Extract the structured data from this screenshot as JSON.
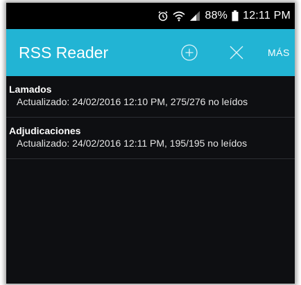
{
  "status_bar": {
    "battery_percent": "88%",
    "time": "12:11 PM",
    "icons": [
      "alarm-icon",
      "wifi-icon",
      "signal-icon",
      "battery-icon"
    ]
  },
  "app_bar": {
    "title": "RSS Reader",
    "actions": [
      {
        "icon": "add-circle-icon"
      },
      {
        "icon": "close-icon"
      }
    ],
    "more_label": "MÁS",
    "color": "#22b4d4"
  },
  "feeds": [
    {
      "title": "Lamados",
      "subtitle": "Actualizado: 24/02/2016 12:10 PM, 275/276 no leídos"
    },
    {
      "title": "Adjudicaciones",
      "subtitle": "Actualizado: 24/02/2016 12:11 PM, 195/195 no leídos"
    }
  ],
  "colors": {
    "background": "#0e0f12",
    "status_bar": "#000000",
    "divider": "#2c2f34"
  }
}
